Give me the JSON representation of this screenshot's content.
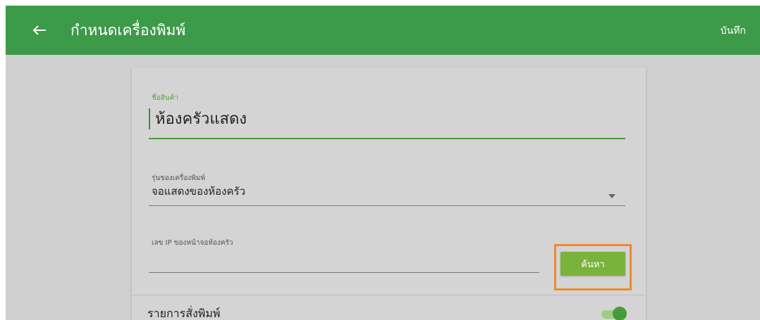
{
  "appbar": {
    "title": "กำหนดเครื่องพิมพ์",
    "save_label": "บันทึก",
    "back_icon": "arrow-left-icon",
    "color": "#3d9a48"
  },
  "form": {
    "product_name": {
      "label": "ชื่อสินค้า",
      "value": "ห้องครัวแสดง"
    },
    "printer_model": {
      "label": "รุ่นของเครื่องพิมพ์",
      "value": "จอแสดงของห้องครัว",
      "icon": "dropdown-arrow-icon"
    },
    "kitchen_ip": {
      "label": "เลข IP ของหน้าจอห้องครัว",
      "value": ""
    },
    "search_button_label": "ค้นหา",
    "print_list": {
      "label": "รายการสั่งพิมพ์",
      "enabled": true
    }
  },
  "colors": {
    "accent": "#4a9a3c",
    "button": "#7ab33b",
    "highlight": "#ee8a2f"
  }
}
